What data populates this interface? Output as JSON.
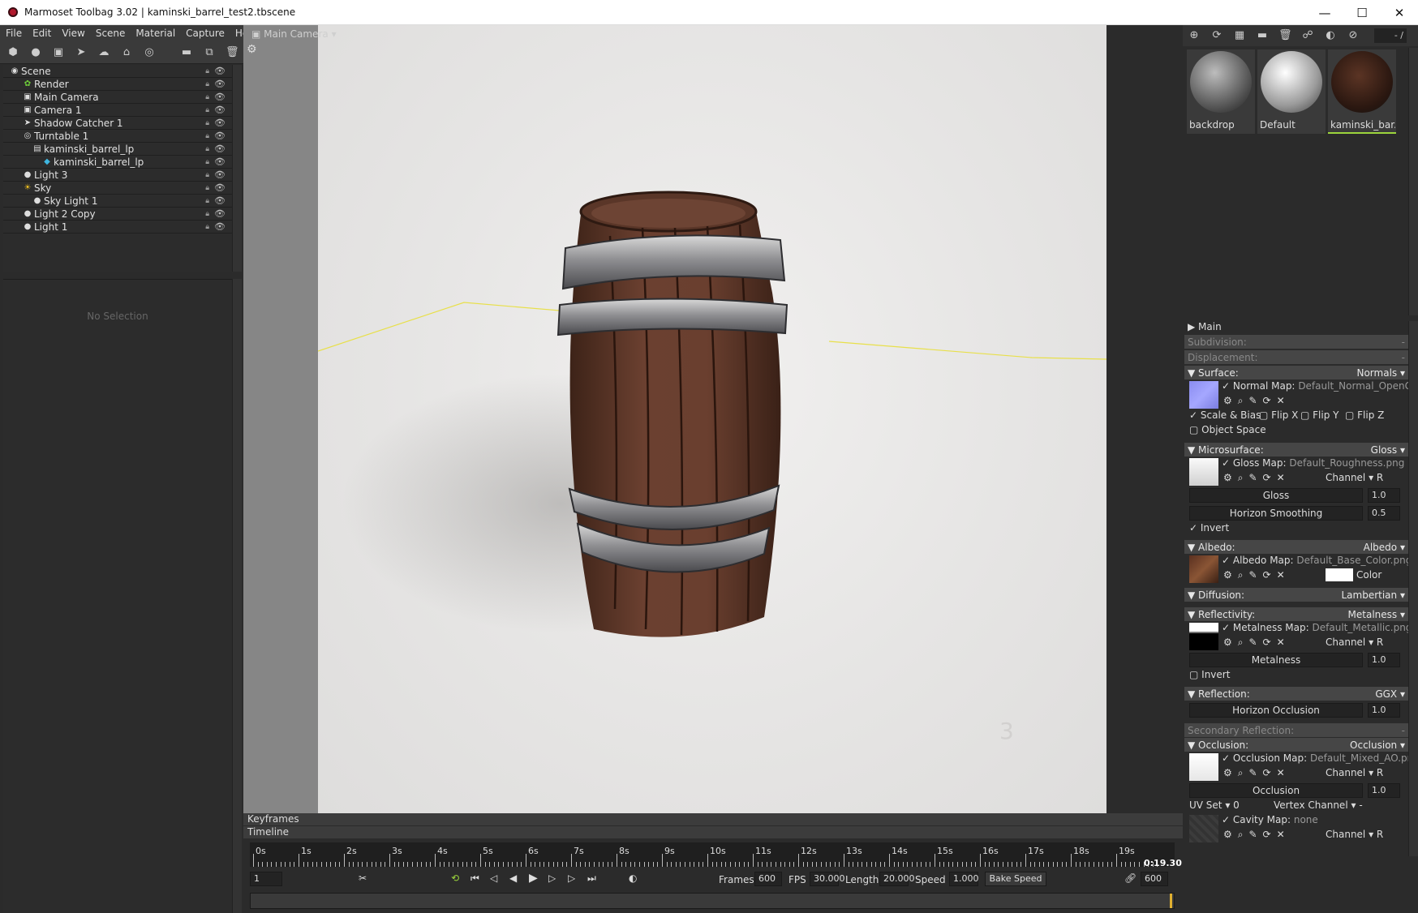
{
  "window": {
    "title": "Marmoset Toolbag 3.02  |  kaminski_barrel_test2.tbscene",
    "minimize": "—",
    "maximize": "☐",
    "close": "✕"
  },
  "menu": [
    "File",
    "Edit",
    "View",
    "Scene",
    "Material",
    "Capture",
    "Help"
  ],
  "scene_tree": [
    {
      "label": "Scene",
      "icon": "scene-icon",
      "glyph": "◉",
      "indent": 0
    },
    {
      "label": "Render",
      "icon": "render-icon",
      "glyph": "✿",
      "indent": 1
    },
    {
      "label": "Main Camera",
      "icon": "camera-icon",
      "glyph": "▣",
      "indent": 1
    },
    {
      "label": "Camera 1",
      "icon": "camera-icon",
      "glyph": "▣",
      "indent": 1
    },
    {
      "label": "Shadow Catcher 1",
      "icon": "shadow-catcher-icon",
      "glyph": "➤",
      "indent": 1
    },
    {
      "label": "Turntable 1",
      "icon": "turntable-icon",
      "glyph": "◎",
      "indent": 1
    },
    {
      "label": "kaminski_barrel_lp",
      "icon": "mesh-file-icon",
      "glyph": "▤",
      "indent": 2
    },
    {
      "label": "kaminski_barrel_lp",
      "icon": "mesh-icon",
      "glyph": "◆",
      "indent": 3
    },
    {
      "label": "Light 3",
      "icon": "light-icon",
      "glyph": "●",
      "indent": 1
    },
    {
      "label": "Sky",
      "icon": "sky-icon",
      "glyph": "☀",
      "indent": 1
    },
    {
      "label": "Sky Light 1",
      "icon": "light-icon",
      "glyph": "●",
      "indent": 2
    },
    {
      "label": "Light 2 Copy",
      "icon": "light-icon",
      "glyph": "●",
      "indent": 1
    },
    {
      "label": "Light 1",
      "icon": "light-icon",
      "glyph": "●",
      "indent": 1
    }
  ],
  "selection_panel": {
    "empty_text": "No Selection"
  },
  "viewport": {
    "camera": "Main Camera"
  },
  "materials": {
    "paging": "- / ",
    "items": [
      {
        "name": "backdrop",
        "selected": false
      },
      {
        "name": "Default",
        "selected": false
      },
      {
        "name": "kaminski_bar...",
        "selected": true
      }
    ]
  },
  "properties": {
    "main": "Main",
    "subdivision": {
      "label": "Subdivision:",
      "value": "-"
    },
    "displacement": {
      "label": "Displacement:",
      "value": "-"
    },
    "surface": {
      "label": "Surface:",
      "value": "Normals"
    },
    "normal_map": {
      "label": "Normal Map:",
      "file": "Default_Normal_OpenGL.p"
    },
    "scale_bias": "Scale & Bias",
    "flip_x": "Flip X",
    "flip_y": "Flip Y",
    "flip_z": "Flip Z",
    "object_space": "Object Space",
    "microsurface": {
      "label": "Microsurface:",
      "value": "Gloss"
    },
    "gloss_map": {
      "label": "Gloss Map:",
      "file": "Default_Roughness.png"
    },
    "channel_label": "Channel",
    "channel_r": "R",
    "gloss": {
      "label": "Gloss",
      "value": "1.0"
    },
    "horizon_smoothing": {
      "label": "Horizon Smoothing",
      "value": "0.5"
    },
    "invert": "Invert",
    "albedo": {
      "label": "Albedo:",
      "value": "Albedo"
    },
    "albedo_map": {
      "label": "Albedo Map:",
      "file": "Default_Base_Color.png"
    },
    "color_label": "Color",
    "diffusion": {
      "label": "Diffusion:",
      "value": "Lambertian"
    },
    "reflectivity": {
      "label": "Reflectivity:",
      "value": "Metalness"
    },
    "metalness_map": {
      "label": "Metalness Map:",
      "file": "Default_Metallic.png"
    },
    "metalness": {
      "label": "Metalness",
      "value": "1.0"
    },
    "invert2": "Invert",
    "reflection": {
      "label": "Reflection:",
      "value": "GGX"
    },
    "horizon_occlusion": {
      "label": "Horizon Occlusion",
      "value": "1.0"
    },
    "secondary_reflection": {
      "label": "Secondary Reflection:",
      "value": "-"
    },
    "occlusion": {
      "label": "Occlusion:",
      "value": "Occlusion"
    },
    "occlusion_map": {
      "label": "Occlusion Map:",
      "file": "Default_Mixed_AO.png"
    },
    "occlusion_slider": {
      "label": "Occlusion",
      "value": "1.0"
    },
    "uv_set": {
      "label": "UV Set",
      "value": "0"
    },
    "vertex_channel": {
      "label": "Vertex Channel",
      "value": "-"
    },
    "cavity_map": {
      "label": "Cavity Map:",
      "file": "none"
    }
  },
  "timeline": {
    "keyframes_label": "Keyframes",
    "timeline_label": "Timeline",
    "ticks": [
      "0s",
      "1s",
      "2s",
      "3s",
      "4s",
      "5s",
      "6s",
      "7s",
      "8s",
      "9s",
      "10s",
      "11s",
      "12s",
      "13s",
      "14s",
      "15s",
      "16s",
      "17s",
      "18s",
      "19s"
    ],
    "end_time": "0:19.30",
    "current_frame": "1",
    "frames_label": "Frames",
    "frames": "600",
    "fps_label": "FPS",
    "fps": "30.000",
    "length_label": "Length",
    "length": "20.000",
    "speed_label": "Speed",
    "speed": "1.000",
    "bake_speed": "Bake Speed",
    "end_frame": "600"
  },
  "colors": {
    "accent": "#9cd53c",
    "panel": "#2b2b2b",
    "section": "#464646"
  }
}
